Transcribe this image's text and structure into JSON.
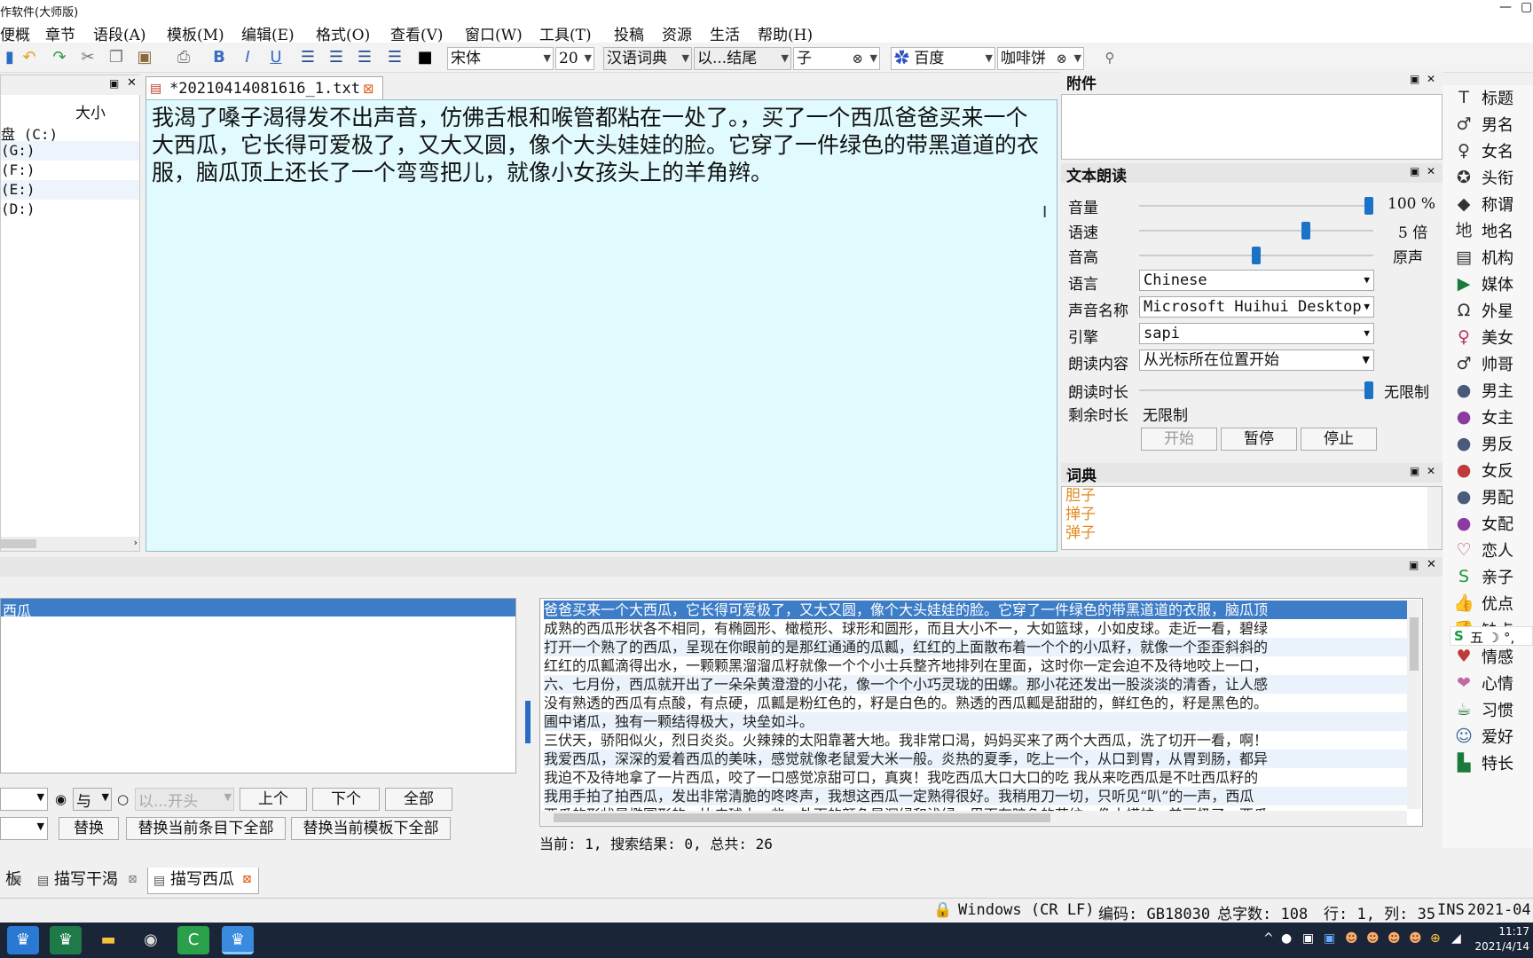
{
  "window": {
    "title": "作软件(大师版)",
    "controls": [
      "—",
      "▢"
    ]
  },
  "menu": [
    "便概",
    "章节",
    "语段(A)",
    "模板(M)",
    "编辑(E)",
    "格式(O)",
    "查看(V)",
    "窗口(W)",
    "工具(T)",
    "投稿",
    "资源",
    "生活",
    "帮助(H)"
  ],
  "toolbar": {
    "font": "宋体",
    "size": "20",
    "dictionary": "汉语词典",
    "ending_mode": "以...结尾",
    "search_char": "子",
    "engine": "百度",
    "search_query": "咖啡饼"
  },
  "left_pane": {
    "column_header": "大小",
    "drives": [
      "盘 (C:)",
      "(G:)",
      "(F:)",
      "(E:)",
      "(D:)"
    ]
  },
  "editor": {
    "tab_title": "*20210414081616_1.txt",
    "content": "我渴了嗓子渴得发不出声音，仿佛舌根和喉管都粘在一处了。，买了一个西瓜爸爸买来一个大西瓜，它长得可爱极了，又大又圆，像个大头娃娃的脸。它穿了一件绿色的带黑道道的衣服，脑瓜顶上还长了一个弯弯把儿，就像小女孩头上的羊角辫。"
  },
  "attachments_panel": {
    "title": "附件"
  },
  "tts_panel": {
    "title": "文本朗读",
    "volume_label": "音量",
    "volume_value": "100 %",
    "volume_level": 1.0,
    "speed_label": "语速",
    "speed_value": "5 倍",
    "speed_level": 0.72,
    "pitch_label": "音高",
    "pitch_value": "原声",
    "pitch_level": 0.5,
    "language_label": "语言",
    "language": "Chinese",
    "voice_label": "声音名称",
    "voice": "Microsoft Huihui Desktop",
    "engine_label": "引擎",
    "engine": "sapi",
    "content_label": "朗读内容",
    "content_mode": "从光标所在位置开始",
    "duration_label": "朗读时长",
    "duration_value": "无限制",
    "duration_level": 1.0,
    "remaining_label": "剩余时长",
    "remaining_value": "无限制",
    "start": "开始",
    "pause": "暂停",
    "stop": "停止"
  },
  "dict_panel": {
    "title": "词典",
    "entries": [
      "胆子",
      "掸子",
      "弹子",
      "·"
    ]
  },
  "tags": [
    {
      "label": "标题",
      "icon": "title-icon",
      "glyph": "T"
    },
    {
      "label": "男名",
      "icon": "male-name-icon",
      "glyph": "♂"
    },
    {
      "label": "女名",
      "icon": "female-name-icon",
      "glyph": "♀"
    },
    {
      "label": "头衔",
      "icon": "medal-icon",
      "glyph": "✪"
    },
    {
      "label": "称谓",
      "icon": "tag-icon",
      "glyph": "◆"
    },
    {
      "label": "地名",
      "icon": "place-icon",
      "glyph": "地"
    },
    {
      "label": "机构",
      "icon": "building-icon",
      "glyph": "▤"
    },
    {
      "label": "媒体",
      "icon": "media-icon",
      "glyph": "▶"
    },
    {
      "label": "外星",
      "icon": "alien-icon",
      "glyph": "Ω"
    },
    {
      "label": "美女",
      "icon": "woman-icon",
      "glyph": "♀"
    },
    {
      "label": "帅哥",
      "icon": "man-icon",
      "glyph": "♂"
    },
    {
      "label": "男主",
      "icon": "male-lead-icon",
      "glyph": "●"
    },
    {
      "label": "女主",
      "icon": "female-lead-icon",
      "glyph": "●"
    },
    {
      "label": "男反",
      "icon": "male-villain-icon",
      "glyph": "●"
    },
    {
      "label": "女反",
      "icon": "female-villain-icon",
      "glyph": "●"
    },
    {
      "label": "男配",
      "icon": "male-support-icon",
      "glyph": "●"
    },
    {
      "label": "女配",
      "icon": "female-support-icon",
      "glyph": "●"
    },
    {
      "label": "恋人",
      "icon": "heart-icon",
      "glyph": "♡"
    },
    {
      "label": "亲子",
      "icon": "ime-icon",
      "glyph": "S"
    },
    {
      "label": "优点",
      "icon": "thumbs-up-icon",
      "glyph": "👍"
    },
    {
      "label": "缺点",
      "icon": "thumbs-down-icon",
      "glyph": "👎"
    },
    {
      "label": "情感",
      "icon": "emotion-icon",
      "glyph": "♥"
    },
    {
      "label": "心情",
      "icon": "mood-icon",
      "glyph": "❤"
    },
    {
      "label": "习惯",
      "icon": "cup-icon",
      "glyph": "☕"
    },
    {
      "label": "爱好",
      "icon": "hobby-icon",
      "glyph": "☺"
    },
    {
      "label": "特长",
      "icon": "skill-icon",
      "glyph": "▙"
    }
  ],
  "ime_bar": "五 ☽ °,",
  "search": {
    "selected_item": "西瓜",
    "logic": "与",
    "mode_placeholder": "以...开头",
    "prev": "上个",
    "next": "下个",
    "all": "全部",
    "replace": "替换",
    "replace_item": "替换当前条目下全部",
    "replace_template": "替换当前模板下全部",
    "status": "当前: 1, 搜索结果: 0, 总共: 26"
  },
  "preview_lines": [
    "爸爸买来一个大西瓜，它长得可爱极了，又大又圆，像个大头娃娃的脸。它穿了一件绿色的带黑道道的衣服，脑瓜顶",
    "成熟的西瓜形状各不相同，有椭圆形、橄榄形、球形和圆形，而且大小不一，大如篮球，小如皮球。走近一看，碧绿",
    "打开一个熟了的西瓜，呈现在你眼前的是那红通通的瓜瓤，红红的上面散布着一个个的小瓜籽，就像一个歪歪斜斜的",
    "红红的瓜瓤滴得出水，一颗颗黑溜溜瓜籽就像一个个小士兵整齐地排列在里面，这时你一定会迫不及待地咬上一口，",
    "六、七月份，西瓜就开出了一朵朵黄澄澄的小花，像一个个小巧灵珑的田螺。那小花还发出一股淡淡的清香，让人感",
    "没有熟透的西瓜有点酸，有点硬，瓜瓤是粉红色的，籽是白色的。熟透的西瓜瓤是甜甜的，鲜红色的，籽是黑色的。",
    "圃中诸瓜，独有一颗结得极大，块垒如斗。",
    "三伏天，骄阳似火，烈日炎炎。火辣辣的太阳靠著大地。我非常口渴，妈妈买来了两个大西瓜，洗了切开一看，啊！",
    "我爱西瓜，深深的爱着西瓜的美味，感觉就像老鼠爱大米一般。炎热的夏季，吃上一个，从口到胃，从胃到肠，都异",
    "我迫不及待地拿了一片西瓜，咬了一口感觉凉甜可口，真爽！我吃西瓜大口大口的吃 我从来吃西瓜是不吐西瓜籽的",
    "我用手拍了拍西瓜，发出非常清脆的咚咚声，我想这西瓜一定熟得很好。我稍用刀一切，只听见“叭”的一声，西瓜",
    "西瓜的形状是椭圆形的，比皮球大一些，外面的颜色是深绿和浅绿，里面有暗色的花纹，像大蟒蛇一美丽极了，西瓜"
  ],
  "bottom_tabs": [
    "板",
    "描写干渴",
    "描写西瓜"
  ],
  "status_bar": {
    "line_ending": "Windows (CR LF)",
    "encoding": "编码: GB18030",
    "char_count": "总字数: 108",
    "position": "行: 1, 列: 35",
    "mode": "INS",
    "date": "2021-04-"
  },
  "taskbar": {
    "time": "11:17",
    "date": "2021/4/14"
  },
  "colors": {
    "editor_bg": "#e0fafe",
    "accent": "#3d7cc7",
    "dict_entry": "#e08a1e",
    "taskbar": "#1a2538"
  }
}
